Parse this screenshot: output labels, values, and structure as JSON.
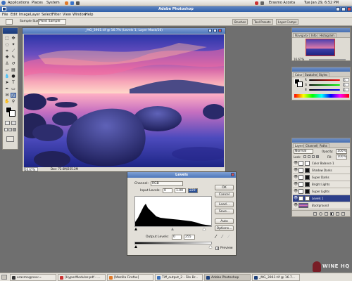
{
  "top_panel": {
    "menus": [
      "Applications",
      "Places",
      "System"
    ],
    "user": "Erasmo Acosta",
    "clock": "Tue Jan 29, 6:52 PM"
  },
  "window_title": "Adobe Photoshop",
  "menubar": [
    "File",
    "Edit",
    "Image",
    "Layer",
    "Select",
    "Filter",
    "View",
    "Window",
    "Help"
  ],
  "options_bar": {
    "sample_size_label": "Sample Size:",
    "sample_size_value": "Point Sample"
  },
  "palette_well": [
    "Brushes",
    "Tool Presets",
    "Layer Comps"
  ],
  "document": {
    "title": "_MG_3961.tif @ 16.7% (Levels 1, Layer Mask/16)",
    "zoom": "16.67%",
    "doc_info": "Doc: 72.6M/255.2M"
  },
  "navigator_panel": {
    "tabs": [
      "Navigator",
      "Info",
      "Histogram"
    ],
    "zoom": "16.67%"
  },
  "color_panel": {
    "tabs": [
      "Color",
      "Swatches",
      "Styles"
    ],
    "channels": [
      {
        "label": "R",
        "value": "0"
      },
      {
        "label": "G",
        "value": "0"
      },
      {
        "label": "B",
        "value": "0"
      }
    ]
  },
  "layers_panel": {
    "tabs": [
      "Layers",
      "Channels",
      "Paths"
    ],
    "blend_mode": "Normal",
    "opacity_label": "Opacity:",
    "opacity": "100%",
    "fill_label": "Fill:",
    "fill": "100%",
    "lock_label": "Lock:",
    "layers": [
      {
        "name": "Color Balance 1",
        "selected": false
      },
      {
        "name": "Shadow Darks",
        "selected": false
      },
      {
        "name": "Super Darks",
        "selected": false
      },
      {
        "name": "Bright Lights",
        "selected": false
      },
      {
        "name": "Super Lights",
        "selected": false
      },
      {
        "name": "Levels 1",
        "selected": true
      },
      {
        "name": "Background",
        "selected": false
      }
    ]
  },
  "levels_dialog": {
    "title": "Levels",
    "channel_label": "Channel:",
    "channel": "RGB",
    "input_label": "Input Levels:",
    "input_black": "0",
    "input_gamma": "1.00",
    "input_white": "229",
    "output_label": "Output Levels:",
    "output_black": "0",
    "output_white": "255",
    "buttons": [
      "OK",
      "Cancel",
      "Load...",
      "Save...",
      "Auto",
      "Options..."
    ],
    "preview_label": "Preview",
    "preview_checked": true
  },
  "taskbar": [
    {
      "label": "erasmo@neo:~",
      "active": false
    },
    {
      "label": "[HyperModular.pdf - ...",
      "active": false
    },
    {
      "label": "[Mozilla Firefox]",
      "active": false
    },
    {
      "label": "Tiff_output_2 - File Br...",
      "active": false
    },
    {
      "label": "Adobe Photoshop",
      "active": true
    },
    {
      "label": "_MG_3961.tif @ 16.7...",
      "active": false
    }
  ],
  "watermark": "WINE HQ",
  "colors": {
    "titlebar": "#4d77ba",
    "selected_layer": "#2c3f8a"
  }
}
